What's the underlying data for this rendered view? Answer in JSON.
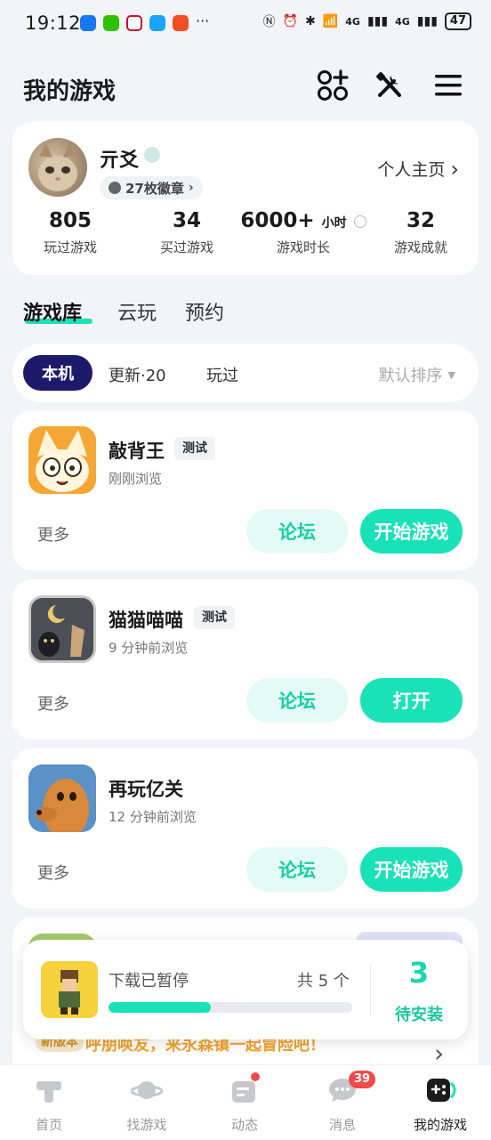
{
  "status_bar": {
    "time": "19:12",
    "battery": "47",
    "signal1": "4G",
    "signal2": "4G"
  },
  "header": {
    "title": "我的游戏"
  },
  "profile": {
    "name": "亓爻",
    "badges": "27枚徽章",
    "homepage_link": "个人主页",
    "stats": [
      {
        "value": "805",
        "label": "玩过游戏"
      },
      {
        "value": "34",
        "label": "买过游戏"
      },
      {
        "value": "6000+",
        "unit": "小时",
        "label": "游戏时长"
      },
      {
        "value": "32",
        "label": "游戏成就"
      }
    ]
  },
  "library_tabs": [
    "游戏库",
    "云玩",
    "预约"
  ],
  "filters": {
    "active": "本机",
    "update": "更新·20",
    "played": "玩过",
    "sort": "默认排序"
  },
  "games": [
    {
      "name": "敲背王",
      "tag": "测试",
      "time": "刚刚浏览",
      "more": "更多",
      "forum": "论坛",
      "action": "开始游戏"
    },
    {
      "name": "猫猫喵喵",
      "tag": "测试",
      "time": "9 分钟前浏览",
      "more": "更多",
      "forum": "论坛",
      "action": "打开"
    },
    {
      "name": "再玩亿关",
      "tag": "",
      "time": "12 分钟前浏览",
      "more": "更多",
      "forum": "论坛",
      "action": "开始游戏"
    }
  ],
  "download": {
    "status": "下载已暂停",
    "total": "共 5 个",
    "progress": 0.42,
    "count": "3",
    "count_label": "待安装"
  },
  "peek": {
    "tag": "新版本",
    "text": "呼朋唤友，来永森镇一起冒险吧！"
  },
  "bottom_nav": [
    {
      "label": "首页"
    },
    {
      "label": "找游戏"
    },
    {
      "label": "动态"
    },
    {
      "label": "消息",
      "badge": "39"
    },
    {
      "label": "我的游戏"
    }
  ],
  "colors": {
    "accent": "#19e2b8",
    "dark_chip": "#1d1a6c",
    "badge_red": "#ef4b4b"
  }
}
